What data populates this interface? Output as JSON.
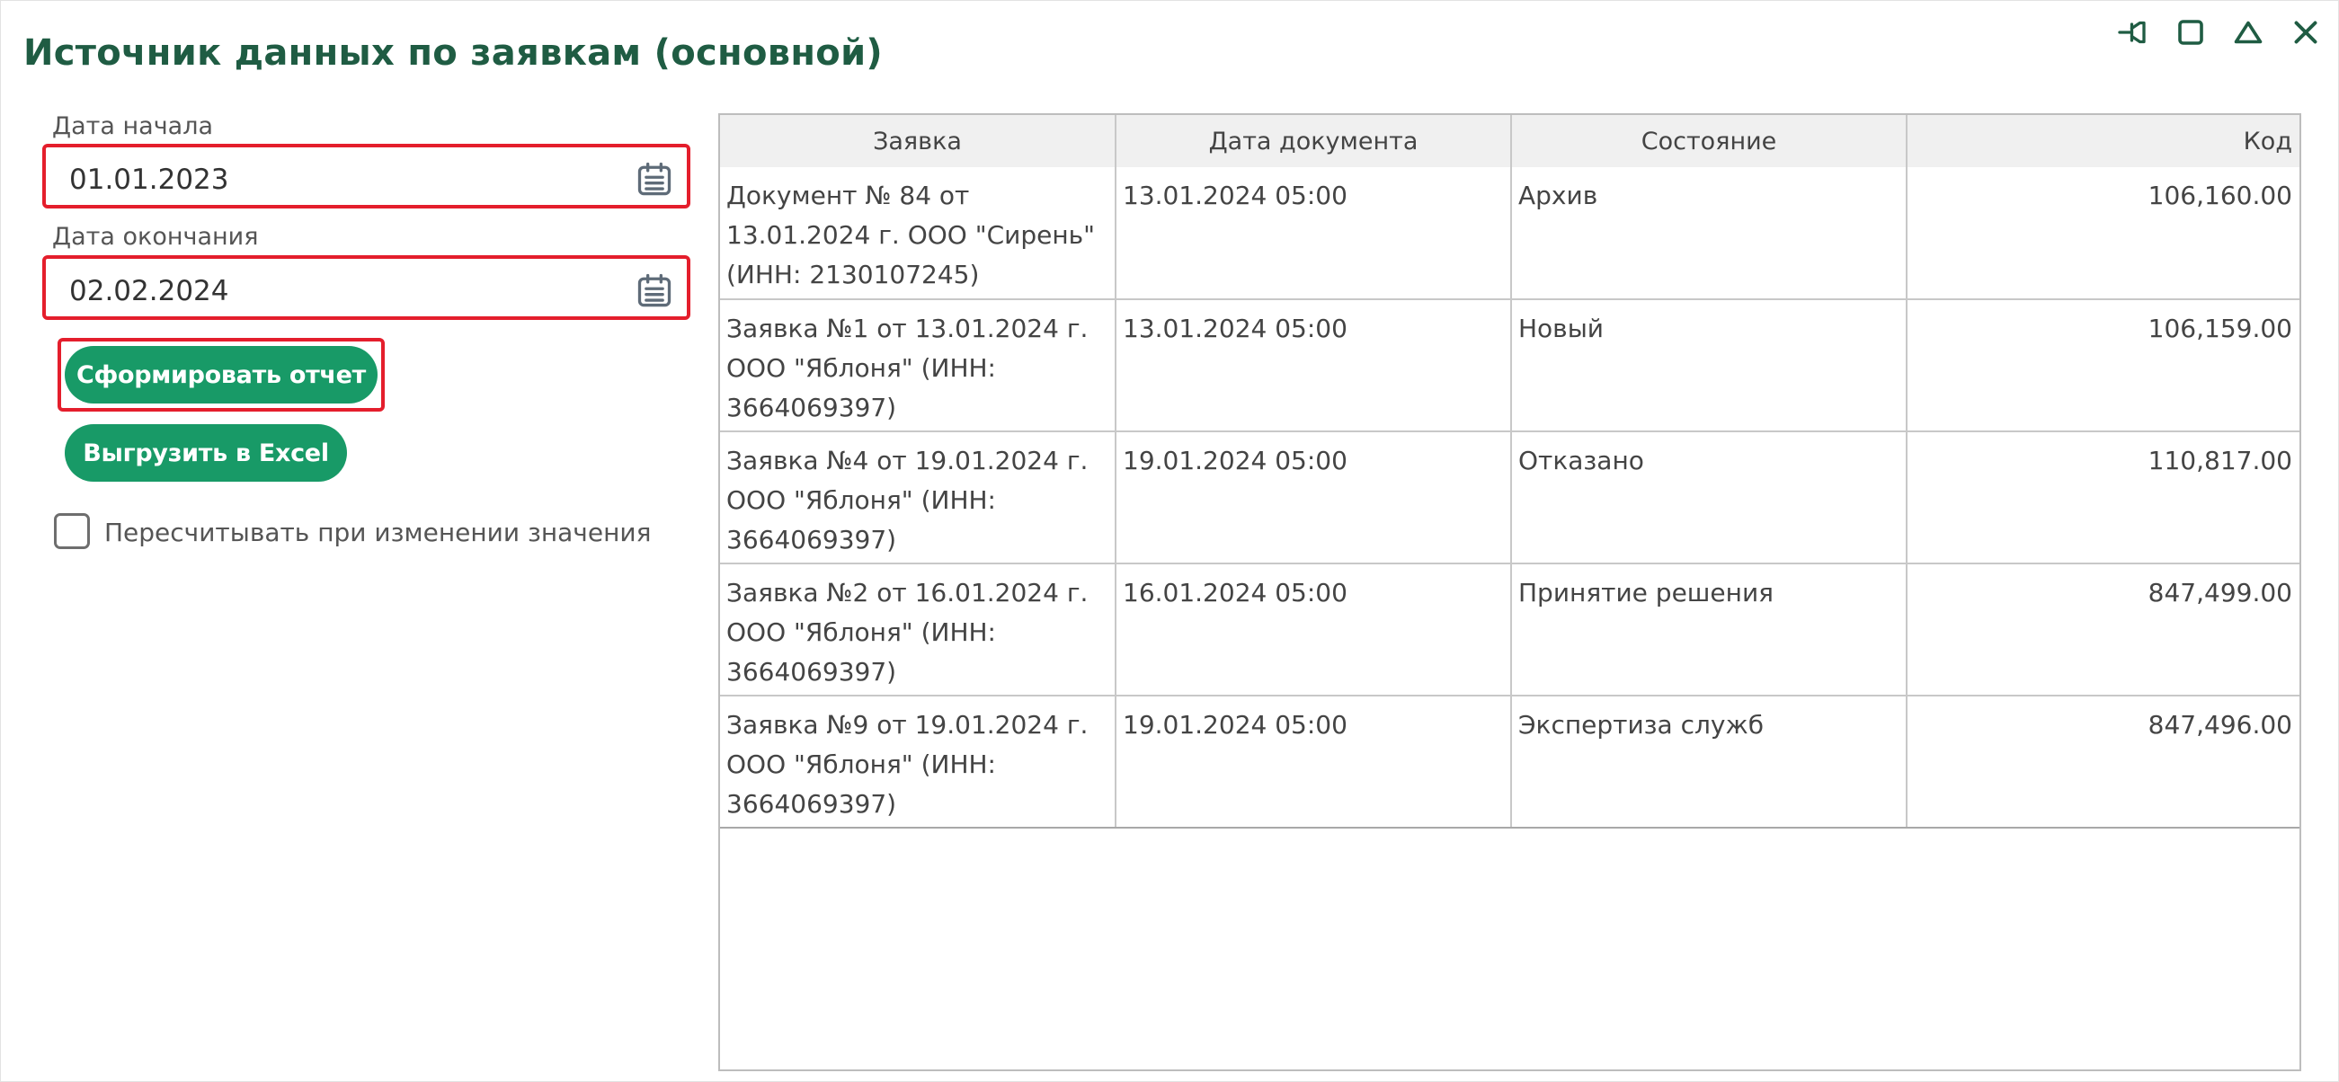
{
  "window": {
    "title": "Источник данных по заявкам (основной)",
    "controls": [
      "pin-icon",
      "maximize-icon",
      "collapse-icon",
      "close-icon"
    ]
  },
  "filters": {
    "start_label": "Дата начала",
    "start_value": "01.01.2023",
    "end_label": "Дата окончания",
    "end_value": "02.02.2024"
  },
  "actions": {
    "build_label": "Сформировать отчет",
    "excel_label": "Выгрузить в Excel",
    "recalc_label": "Пересчитывать при изменении значения",
    "recalc_checked": false
  },
  "table": {
    "columns": [
      "Заявка",
      "Дата документа",
      "Состояние",
      "Код"
    ],
    "rows": [
      [
        "Документ № 84 от 13.01.2024 г. ООО \"Сирень\" (ИНН: 2130107245)",
        "13.01.2024 05:00",
        "Архив",
        "106,160.00"
      ],
      [
        "Заявка №1 от 13.01.2024 г. ООО \"Яблоня\" (ИНН: 3664069397)",
        "13.01.2024 05:00",
        "Новый",
        "106,159.00"
      ],
      [
        "Заявка №4 от 19.01.2024 г. ООО \"Яблоня\" (ИНН: 3664069397)",
        "19.01.2024 05:00",
        "Отказано",
        "110,817.00"
      ],
      [
        "Заявка №2 от 16.01.2024 г. ООО \"Яблоня\" (ИНН: 3664069397)",
        "16.01.2024 05:00",
        "Принятие решения",
        "847,499.00"
      ],
      [
        "Заявка №9 от 19.01.2024 г. ООО \"Яблоня\" (ИНН: 3664069397)",
        "19.01.2024 05:00",
        "Экспертиза служб",
        "847,496.00"
      ]
    ]
  },
  "colors": {
    "title": "#1f5c43",
    "button": "#189a67",
    "highlight": "#e41e2c",
    "icon": "#1f5c43"
  }
}
